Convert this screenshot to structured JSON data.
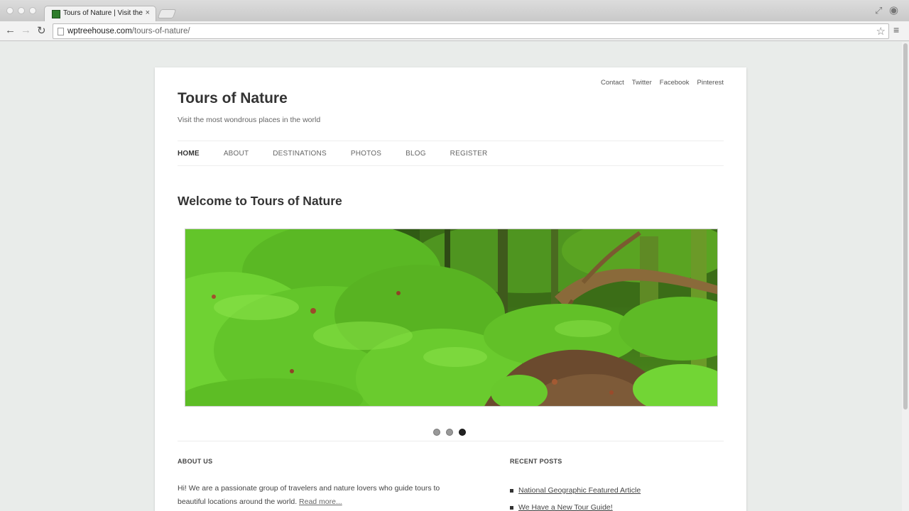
{
  "browser": {
    "tab_title": "Tours of Nature | Visit the most wondrous places in the world",
    "tab_close": "×",
    "url_host": "wptreehouse.com",
    "url_path": "/tours-of-nature/"
  },
  "site": {
    "title": "Tours of Nature",
    "description": "Visit the most wondrous places in the world",
    "secondary_nav": [
      "Contact",
      "Twitter",
      "Facebook",
      "Pinterest"
    ],
    "main_nav": [
      "HOME",
      "ABOUT",
      "DESTINATIONS",
      "PHOTOS",
      "BLOG",
      "REGISTER"
    ],
    "current_nav": "HOME",
    "page_heading": "Welcome to Tours of Nature",
    "slider": {
      "slide_count": 3,
      "active_slide": 3
    },
    "about": {
      "title": "ABOUT US",
      "text": "Hi! We are a passionate group of travelers and nature lovers who guide tours to beautiful locations around the world.",
      "read_more": "Read more..."
    },
    "recent_posts": {
      "title": "RECENT POSTS",
      "items": [
        "National Geographic Featured Article",
        "We Have a New Tour Guide!"
      ]
    }
  },
  "colors": {
    "page_bg": "#e9ecea",
    "moss_green": "#5fc421",
    "text_dark": "#333333"
  }
}
